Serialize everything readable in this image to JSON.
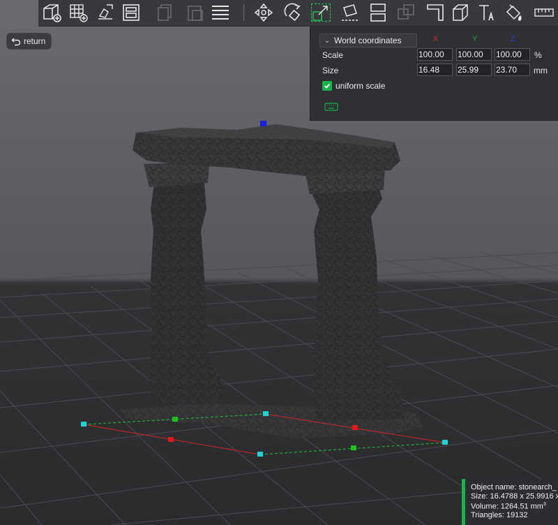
{
  "toolbar": {
    "tools": [
      "add-model-icon",
      "add-plate-icon",
      "auto-arrange-icon",
      "layout-icon",
      "copy-icon",
      "paste-icon",
      "list-icon",
      "move-icon",
      "rotate-icon",
      "scale-icon",
      "lay-flat-icon",
      "split-icon",
      "cut-icon",
      "support-icon",
      "cube-icon",
      "text-icon",
      "paint-icon",
      "measure-icon"
    ]
  },
  "return_button": {
    "label": "return"
  },
  "scale_panel": {
    "coord_system": "World coordinates",
    "axes": {
      "x": "X",
      "y": "Y",
      "z": "Z"
    },
    "axis_colors": {
      "x": "#d8272e",
      "y": "#1ea042",
      "z": "#2a3fd8"
    },
    "scale": {
      "label": "Scale",
      "x": "100.00",
      "y": "100.00",
      "z": "100.00",
      "unit": "%"
    },
    "size": {
      "label": "Size",
      "x": "16.48",
      "y": "25.99",
      "z": "23.70",
      "unit": "mm"
    },
    "uniform_scale": {
      "label": "uniform scale",
      "checked": true
    }
  },
  "object_info": {
    "name": "Object name: stonearch_",
    "size": "Size: 16.4788 x 25.9916 x",
    "volume": "Volume: 1264.51 mm",
    "volume_sup": "3",
    "triangles": "Triangles: 19132"
  },
  "colors": {
    "accent": "#18b34a",
    "panel_bg": "#2f3033",
    "handle_cyan": "#1ed4d4",
    "handle_red": "#e01b1b",
    "handle_green": "#1ec21e",
    "handle_blue": "#1a1ee0"
  }
}
